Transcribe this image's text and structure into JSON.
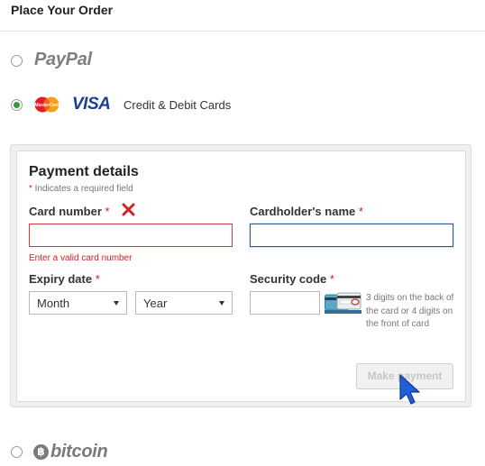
{
  "page": {
    "title": "Place Your Order"
  },
  "payment_methods": {
    "paypal": {
      "logo_text": "PayPal",
      "selected": false
    },
    "cards": {
      "label": "Credit & Debit Cards",
      "visa_text": "VISA",
      "mastercard_text": "MasterCard",
      "selected": true
    },
    "bitcoin": {
      "logo_symbol": "฿",
      "logo_text": "bitcoin",
      "selected": false
    }
  },
  "payment_details": {
    "title": "Payment details",
    "required_note": "* Indicates a required field",
    "card_number": {
      "label": "Card number",
      "required_mark": "*",
      "value": "",
      "error": "Enter a valid card number"
    },
    "cardholder_name": {
      "label": "Cardholder's name",
      "required_mark": "*",
      "value": ""
    },
    "expiry_date": {
      "label": "Expiry date",
      "required_mark": "*",
      "month": "Month",
      "year": "Year"
    },
    "security_code": {
      "label": "Security code",
      "required_mark": "*",
      "value": "",
      "hint": "3 digits on the back of the card or 4 digits on the front of card"
    },
    "submit_label": "Make payment"
  },
  "colors": {
    "error": "#cc2222",
    "visa": "#1a3f8f",
    "selected_radio": "#3a9b3a",
    "focus_border": "#2d5a86"
  }
}
